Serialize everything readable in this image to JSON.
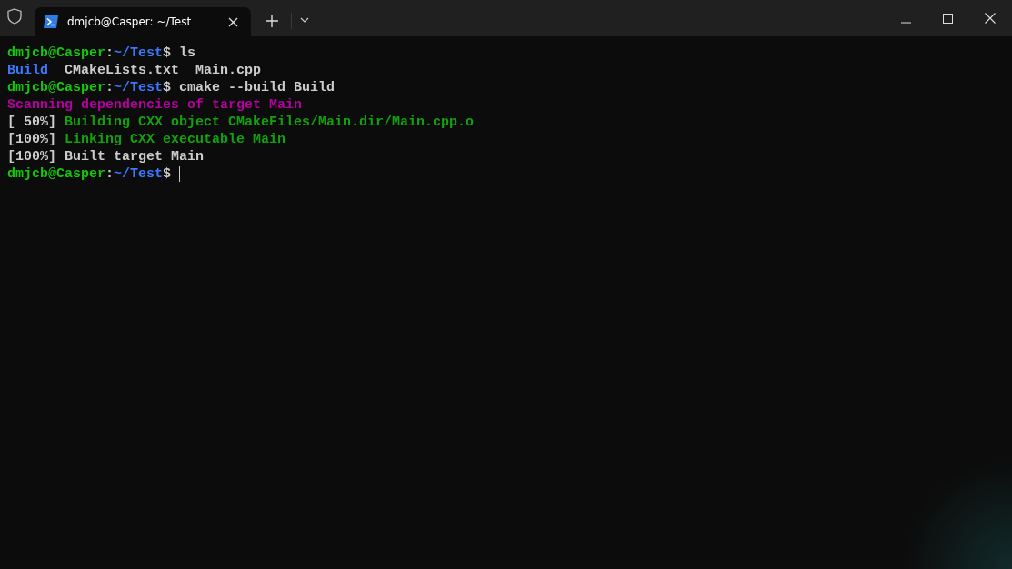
{
  "tabs": [
    {
      "title": "dmjcb@Casper: ~/Test",
      "selected": true
    }
  ],
  "terminal": {
    "lines": [
      {
        "segments": [
          {
            "text": "dmjcb@Casper",
            "kind": "user"
          },
          {
            "text": ":",
            "kind": "plain"
          },
          {
            "text": "~/Test",
            "kind": "path"
          },
          {
            "text": "$ ls",
            "kind": "plain"
          }
        ]
      },
      {
        "segments": [
          {
            "text": "Build",
            "kind": "dir"
          },
          {
            "text": "CMakeLists.txt",
            "kind": "plain"
          },
          {
            "text": "Main.cpp",
            "kind": "plain"
          }
        ]
      },
      {
        "segments": [
          {
            "text": "dmjcb@Casper",
            "kind": "user"
          },
          {
            "text": ":",
            "kind": "plain"
          },
          {
            "text": "~/Test",
            "kind": "path"
          },
          {
            "text": "$ cmake --build Build",
            "kind": "plain"
          }
        ]
      },
      {
        "segments": [
          {
            "text": "Scanning dependencies of target Main",
            "kind": "magenta"
          }
        ]
      },
      {
        "segments": [
          {
            "text": "[ 50%]",
            "kind": "plain"
          },
          {
            "text": "Building CXX object CMakeFiles/Main.dir/Main.cpp.o",
            "kind": "green"
          }
        ]
      },
      {
        "segments": [
          {
            "text": "[100%]",
            "kind": "plain"
          },
          {
            "text": "Linking CXX executable Main",
            "kind": "green"
          }
        ]
      },
      {
        "segments": [
          {
            "text": "[100%]",
            "kind": "plain"
          },
          {
            "text": "Built target Main",
            "kind": "plain"
          }
        ]
      },
      {
        "segments": [
          {
            "text": "dmjcb@Casper",
            "kind": "user"
          },
          {
            "text": ":",
            "kind": "plain"
          },
          {
            "text": "~/Test",
            "kind": "path"
          },
          {
            "text": "$",
            "kind": "plain"
          }
        ],
        "cursor": true
      }
    ]
  }
}
